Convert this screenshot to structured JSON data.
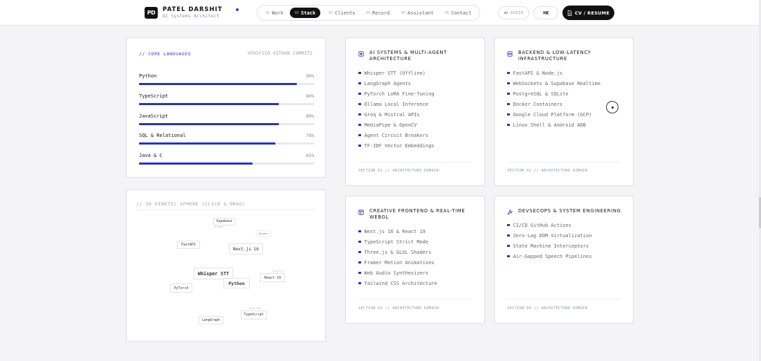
{
  "brand": {
    "logo": "PD",
    "name": "PATEL DARSHIT",
    "subtitle": "AI Systems Architect"
  },
  "nav": {
    "items": [
      {
        "num": "01",
        "label": "Work",
        "active": false
      },
      {
        "num": "02",
        "label": "Stack",
        "active": true
      },
      {
        "num": "03",
        "label": "Clients",
        "active": false
      },
      {
        "num": "04",
        "label": "Record",
        "active": false
      },
      {
        "num": "05",
        "label": "Assistant",
        "active": false
      },
      {
        "num": "06",
        "label": "Contact",
        "active": false
      }
    ]
  },
  "header_actions": {
    "audio_label": "AUDIO",
    "shortcut_label": "⌘K",
    "cv_label": "CV / RESUME"
  },
  "languages": {
    "title": "// CORE LANGUAGES",
    "meta": "VERIFIED GITHUB COMMITS",
    "items": [
      {
        "name": "Python",
        "pct_label": "90%",
        "value": 0.9
      },
      {
        "name": "TypeScript",
        "pct_label": "80%",
        "value": 0.8
      },
      {
        "name": "JavaScript",
        "pct_label": "80%",
        "value": 0.8
      },
      {
        "name": "SQL & Relational",
        "pct_label": "78%",
        "value": 0.78
      },
      {
        "name": "Java & C",
        "pct_label": "65%",
        "value": 0.65
      }
    ]
  },
  "sphere": {
    "title": "// 3D KINETIC SPHERE (CLICK & DRAG)",
    "nodes": [
      "Supabase",
      "Docker",
      "FastAPI",
      "Next.js 16",
      "Whisper STT",
      "React 19",
      "Python",
      "PyTorch",
      "TypeScript",
      "LangGraph"
    ],
    "faint": [
      "Ollama",
      "Three.js",
      "Groq API"
    ]
  },
  "areas": [
    {
      "title": "AI SYSTEMS & MULTI-AGENT ARCHITECTURE",
      "icon": "cpu-icon",
      "items": [
        "Whisper STT (Offline)",
        "LangGraph Agents",
        "PyTorch LoRA Fine-Tuning",
        "Ollama Local Inference",
        "Groq & Mistral APIs",
        "MediaPipe & OpenCV",
        "Agent Circuit Breakers",
        "TF-IDF Vector Embeddings"
      ],
      "footer": "SECTION 01 // ARCHITECTURE DOMAIN"
    },
    {
      "title": "BACKEND & LOW-LATENCY INFRASTRUCTURE",
      "icon": "server-icon",
      "items": [
        "FastAPI & Node.js",
        "WebSockets & Supabase Realtime",
        "PostgreSQL & SQLite",
        "Docker Containers",
        "Google Cloud Platform (GCP)",
        "Linux Shell & Android ADB"
      ],
      "footer": "SECTION 02 // ARCHITECTURE DOMAIN"
    },
    {
      "title": "CREATIVE FRONTEND & REAL-TIME WEBGL",
      "icon": "layout-icon",
      "items": [
        "Next.js 16 & React 19",
        "TypeScript Strict Mode",
        "Three.js & GLSL Shaders",
        "Framer Motion Animations",
        "Web Audio Synthesizers",
        "Tailwind CSS Architecture"
      ],
      "footer": "SECTION 03 // ARCHITECTURE DOMAIN"
    },
    {
      "title": "DEVSECOPS & SYSTEM ENGINEERING",
      "icon": "wrench-icon",
      "items": [
        "CI/CD GitHub Actions",
        "Zero-Lag DOM Virtualization",
        "State Machine Interceptors",
        "Air-Gapped Speech Pipelines"
      ],
      "footer": "SECTION 04 // ARCHITECTURE DOMAIN"
    }
  ],
  "colors": {
    "accent": "#2431c8",
    "ink": "#111111",
    "muted": "#888888",
    "background": "#f4f4f6"
  }
}
